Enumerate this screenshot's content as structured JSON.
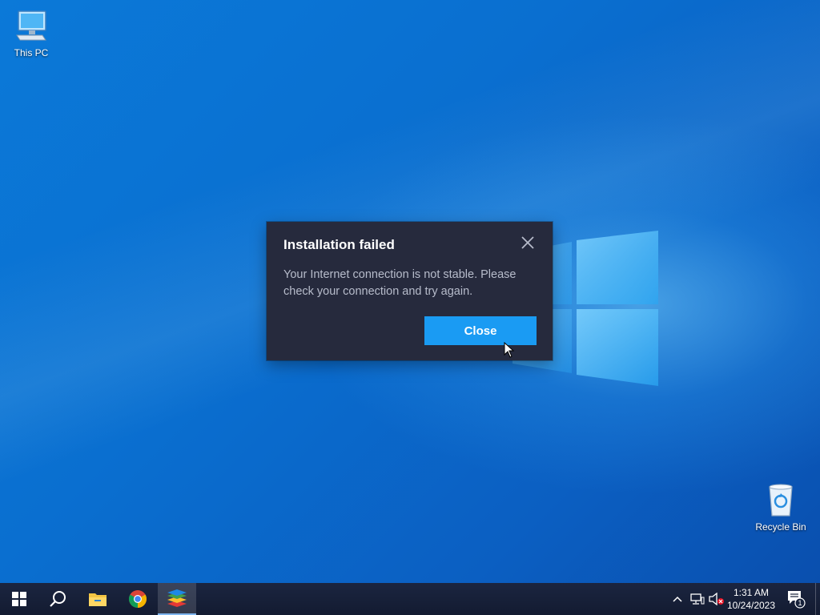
{
  "desktop": {
    "icons": [
      {
        "label": "This PC",
        "icon": "computer-icon"
      },
      {
        "label": "Recycle Bin",
        "icon": "recycle-bin-icon"
      }
    ]
  },
  "dialog": {
    "title": "Installation failed",
    "message": "Your Internet connection is not stable. Please check your connection and try again.",
    "close_button_label": "Close",
    "accent_color": "#1a9bf3",
    "background_color": "#262a3d"
  },
  "taskbar": {
    "pinned": [
      {
        "name": "start-button",
        "icon": "windows-logo-icon"
      },
      {
        "name": "search-button",
        "icon": "search-icon"
      },
      {
        "name": "file-explorer-button",
        "icon": "folder-icon"
      },
      {
        "name": "chrome-button",
        "icon": "chrome-icon"
      },
      {
        "name": "bluestacks-button",
        "icon": "bluestacks-icon",
        "active": true
      }
    ],
    "tray": {
      "time": "1:31 AM",
      "date": "10/24/2023",
      "notification_count": "1"
    }
  }
}
